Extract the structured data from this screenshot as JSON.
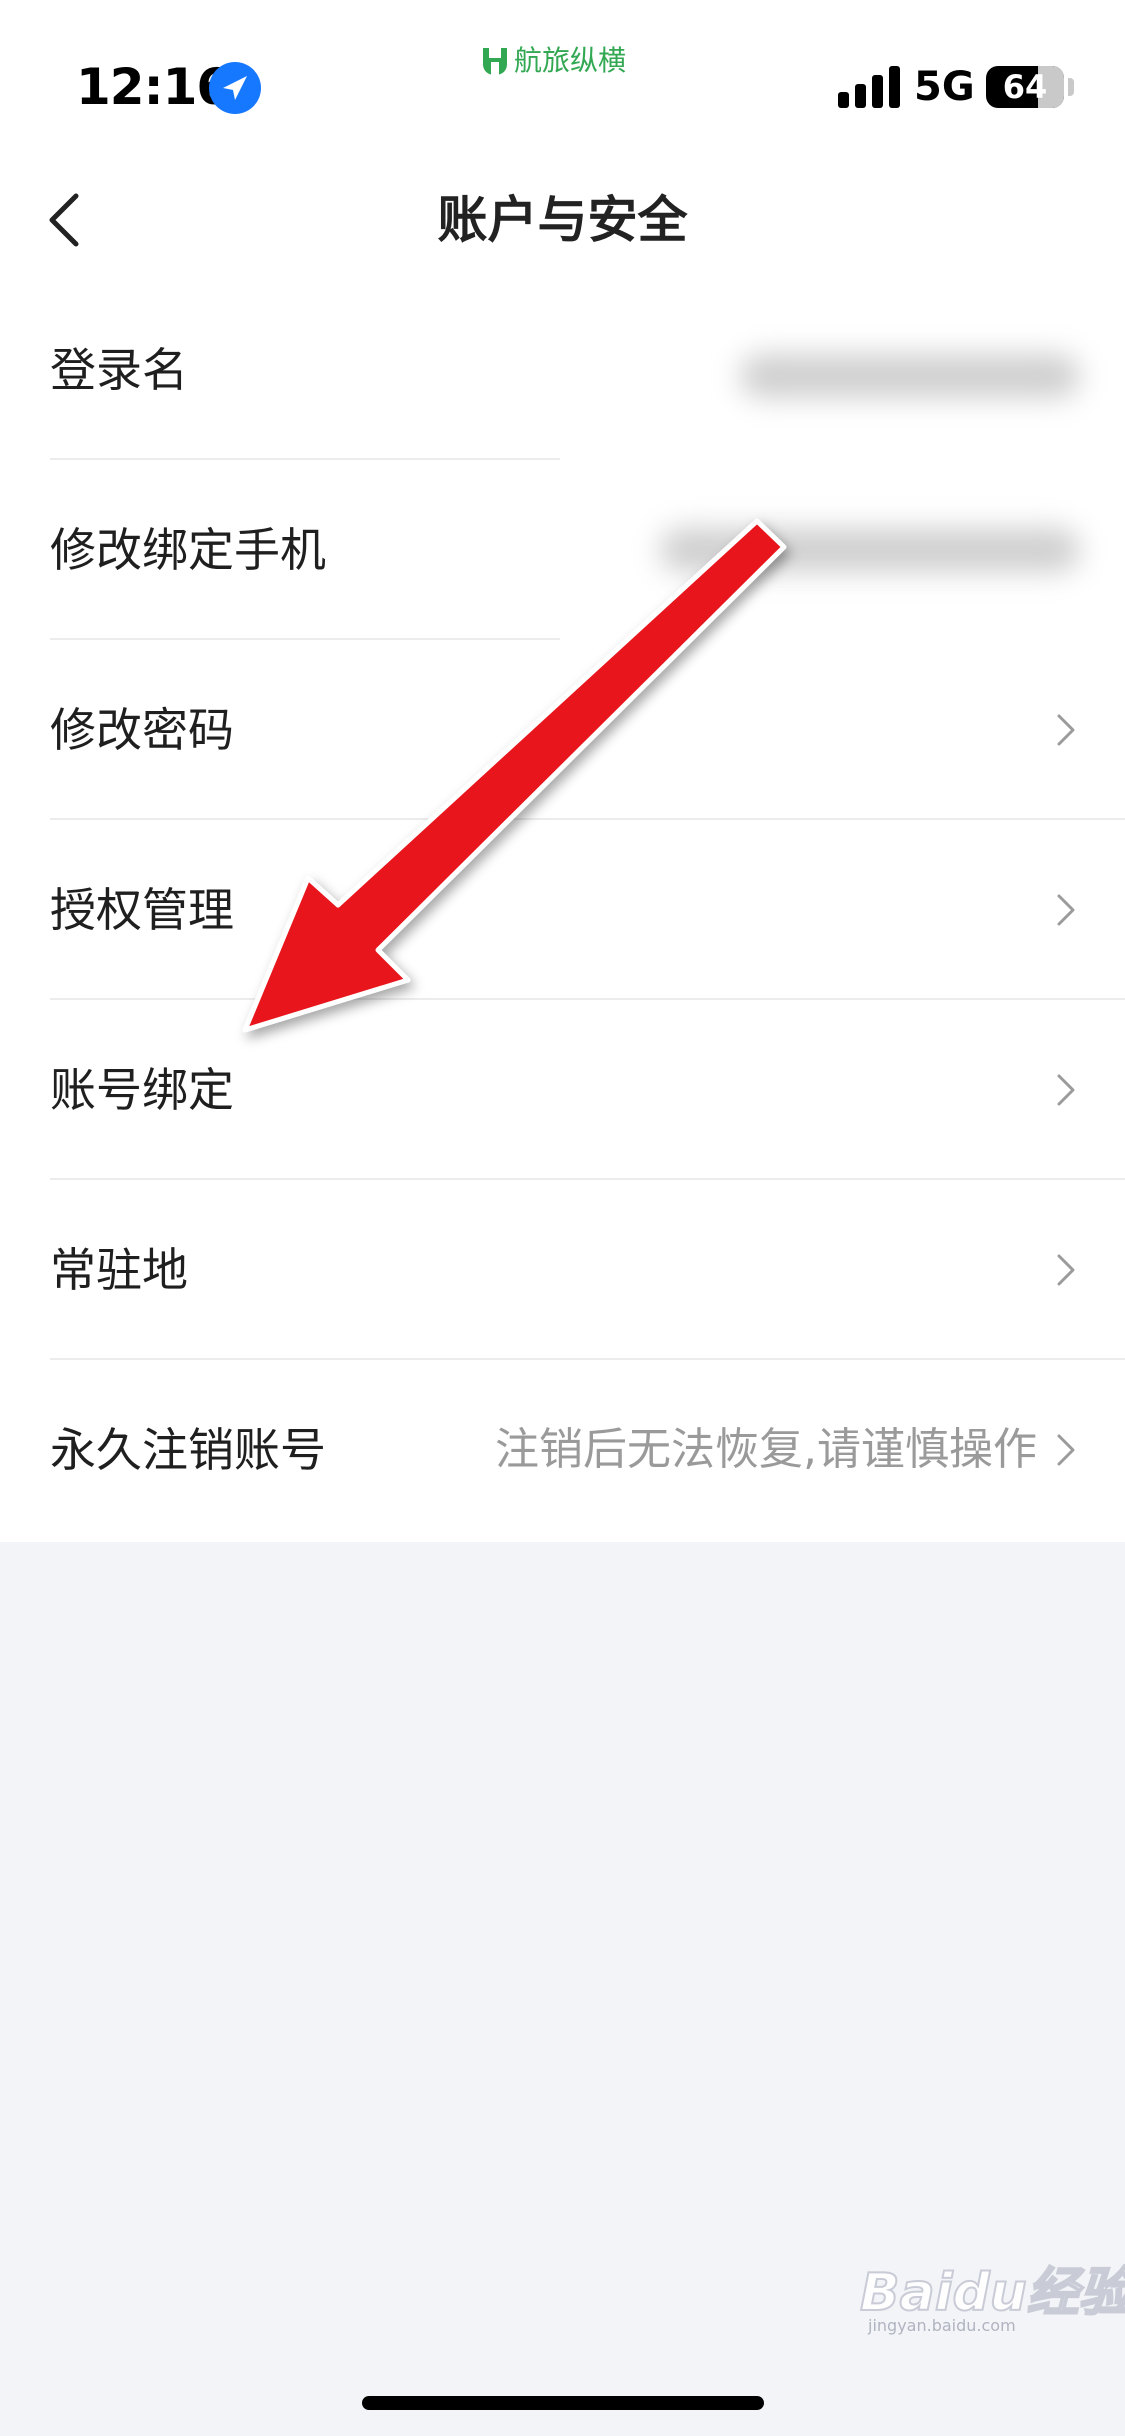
{
  "status_bar": {
    "time": "12:16",
    "brand_text": "航旅纵横",
    "network": "5G",
    "battery": "64",
    "brand_color": "#33a853",
    "location_color": "#1677ff"
  },
  "nav": {
    "back_icon": "chevron-left-icon",
    "title": "账户与安全"
  },
  "settings": {
    "items": [
      {
        "label": "登录名",
        "value": "",
        "value_blurred": true
      },
      {
        "label": "修改绑定手机",
        "value": "",
        "value_blurred": true
      },
      {
        "label": "修改密码"
      },
      {
        "label": "授权管理"
      },
      {
        "label": "账号绑定"
      },
      {
        "label": "常驻地"
      },
      {
        "label": "永久注销账号",
        "hint": "注销后无法恢复,请谨慎操作"
      }
    ]
  },
  "annotation": {
    "color": "#e8141b"
  },
  "watermark": {
    "text": "Baidu经验",
    "sub": "jingyan.baidu.com"
  }
}
